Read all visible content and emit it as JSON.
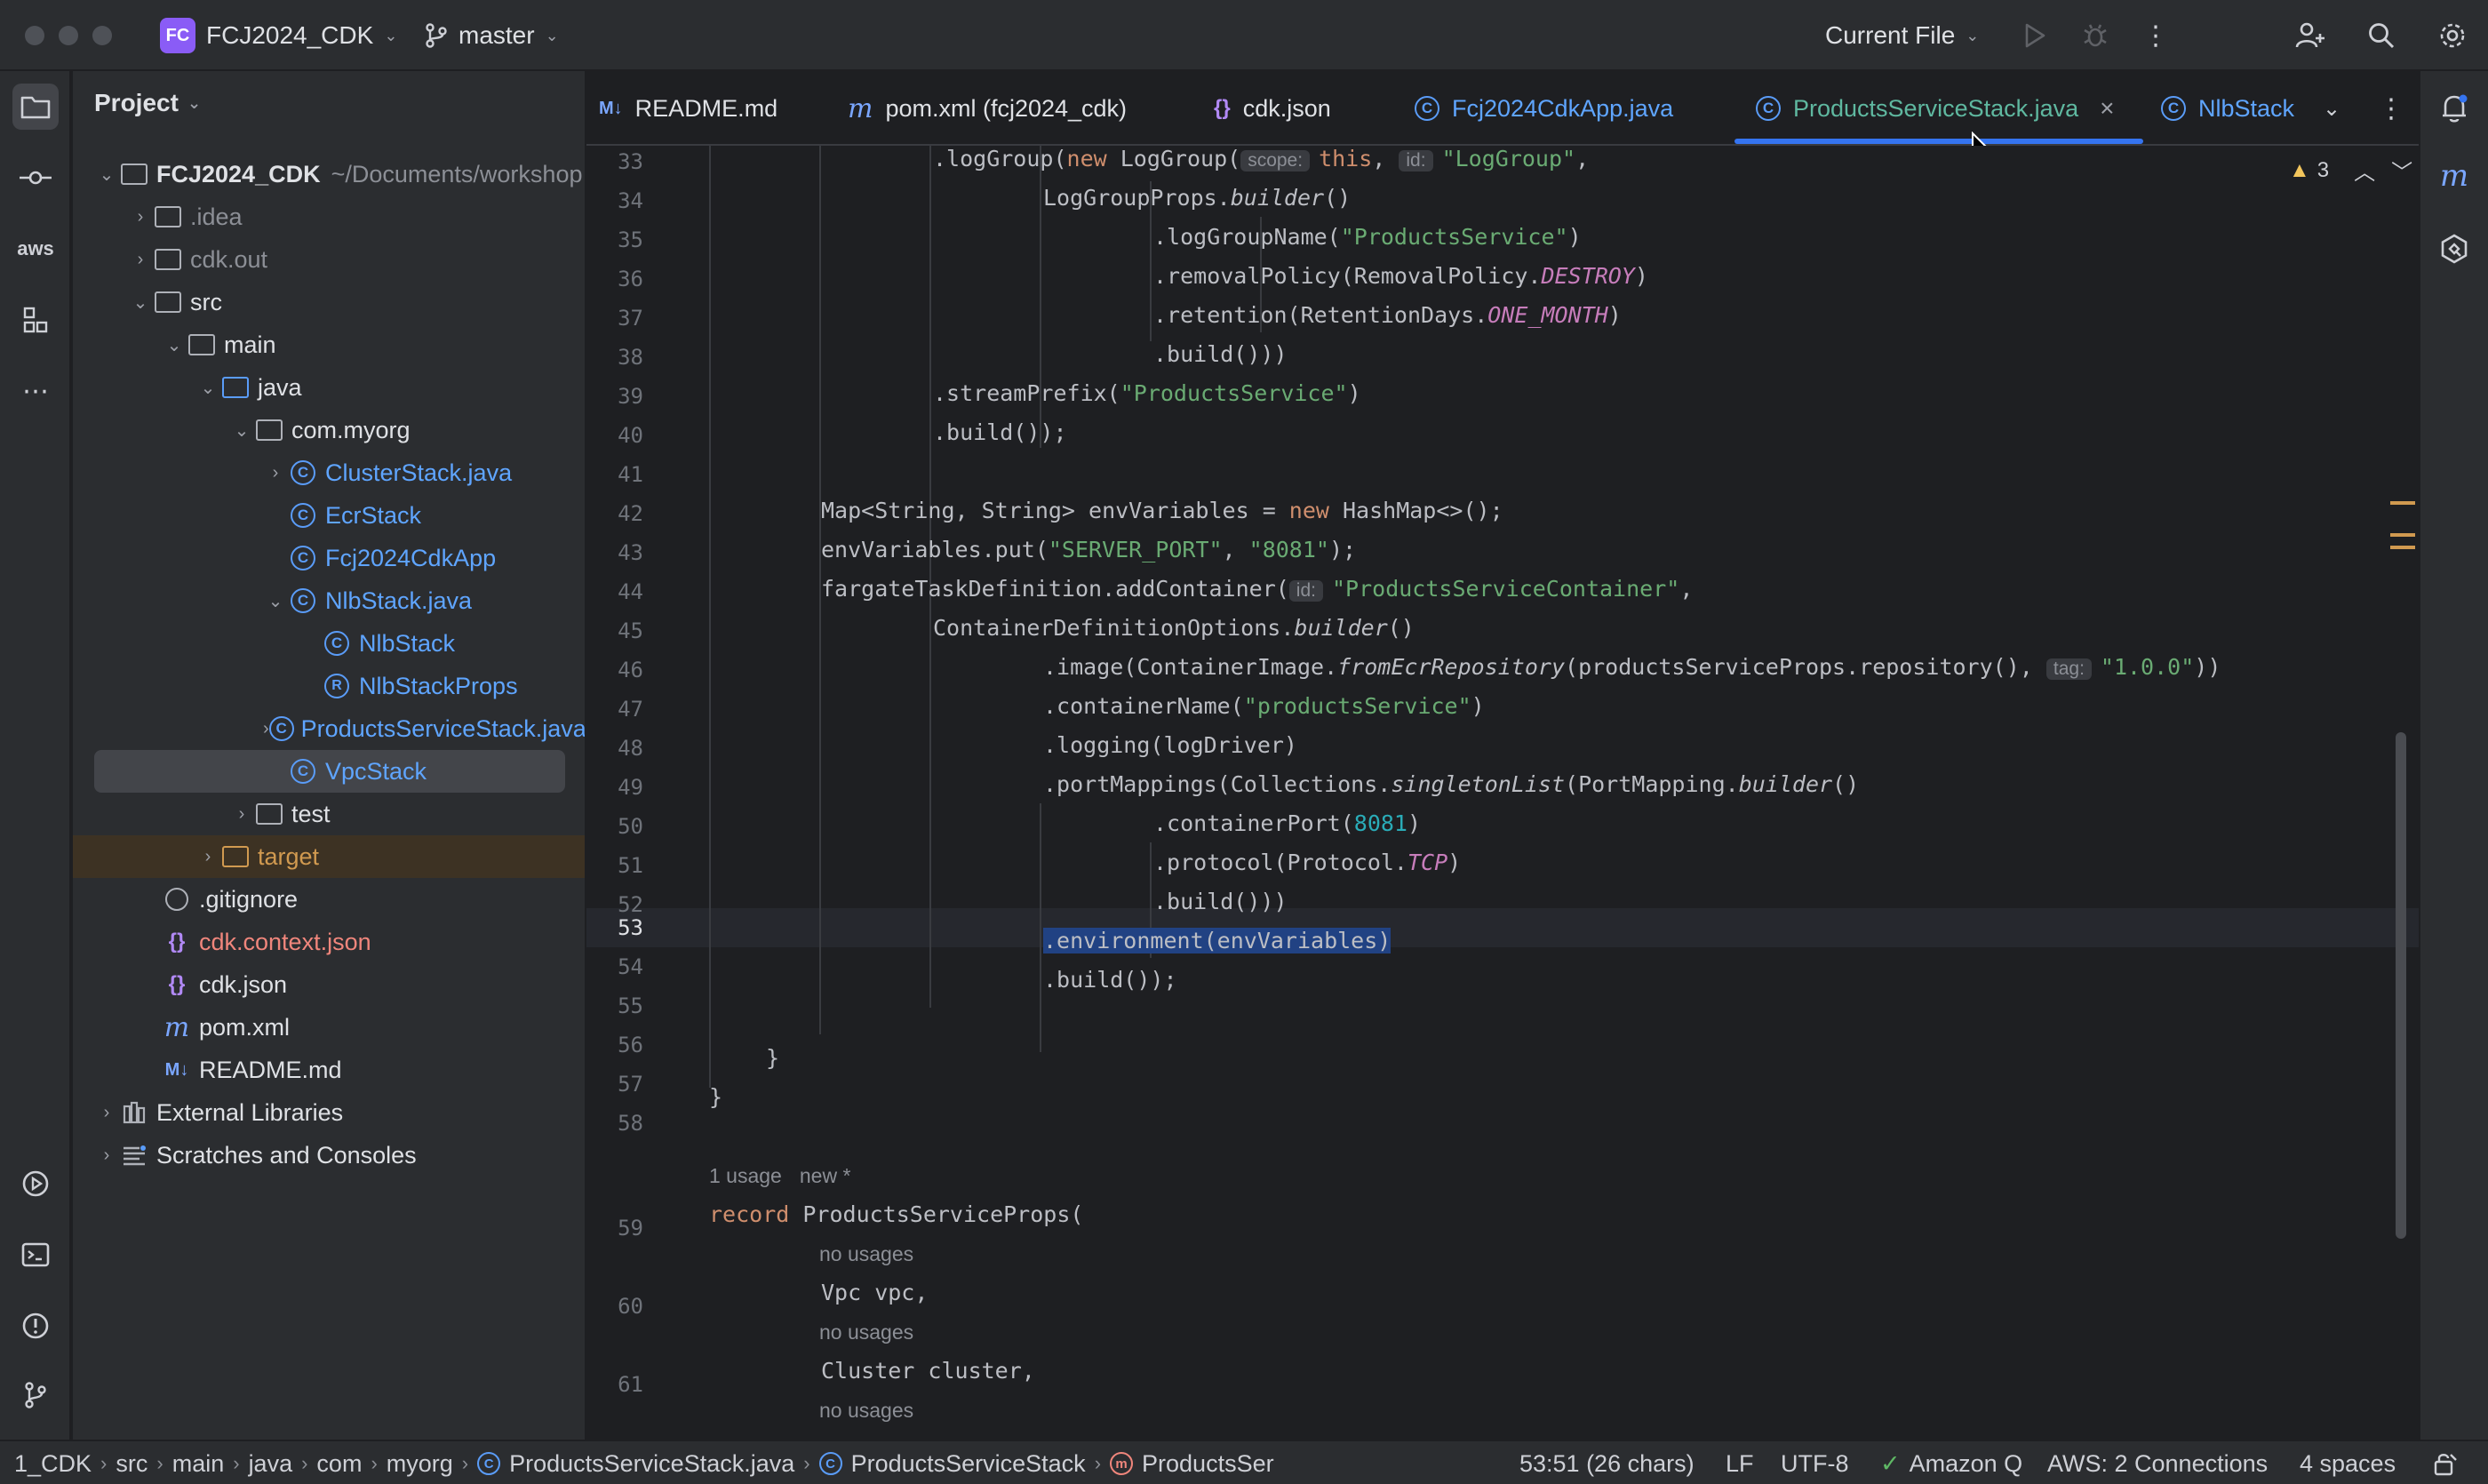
{
  "titlebar": {
    "project_badge": "FC",
    "project_name": "FCJ2024_CDK",
    "branch": "master",
    "run_config": "Current File"
  },
  "project_panel": {
    "title": "Project",
    "root_name": "FCJ2024_CDK",
    "root_path": "~/Documents/workshop",
    "items": [
      {
        "label": ".idea"
      },
      {
        "label": "cdk.out"
      },
      {
        "label": "src"
      },
      {
        "label": "main"
      },
      {
        "label": "java"
      },
      {
        "label": "com.myorg"
      },
      {
        "label": "ClusterStack.java"
      },
      {
        "label": "EcrStack"
      },
      {
        "label": "Fcj2024CdkApp"
      },
      {
        "label": "NlbStack.java"
      },
      {
        "label": "NlbStack"
      },
      {
        "label": "NlbStackProps"
      },
      {
        "label": "ProductsServiceStack.java"
      },
      {
        "label": "VpcStack"
      },
      {
        "label": "test"
      },
      {
        "label": "target"
      },
      {
        "label": ".gitignore"
      },
      {
        "label": "cdk.context.json"
      },
      {
        "label": "cdk.json"
      },
      {
        "label": "pom.xml"
      },
      {
        "label": "README.md"
      },
      {
        "label": "External Libraries"
      },
      {
        "label": "Scratches and Consoles"
      }
    ]
  },
  "tabs": [
    {
      "icon": "M↓",
      "label": "README.md"
    },
    {
      "icon": "m",
      "label": "pom.xml (fcj2024_cdk)"
    },
    {
      "icon": "{}",
      "label": "cdk.json"
    },
    {
      "icon": "C",
      "label": "Fcj2024CdkApp.java"
    },
    {
      "icon": "C",
      "label": "ProductsServiceStack.java"
    },
    {
      "icon": "C",
      "label": "NlbStack"
    }
  ],
  "editor": {
    "warning_count": "3",
    "lines": [
      {
        "n": "33"
      },
      {
        "n": "34"
      },
      {
        "n": "35"
      },
      {
        "n": "36"
      },
      {
        "n": "37"
      },
      {
        "n": "38"
      },
      {
        "n": "39"
      },
      {
        "n": "40"
      },
      {
        "n": "41"
      },
      {
        "n": "42"
      },
      {
        "n": "43"
      },
      {
        "n": "44"
      },
      {
        "n": "45"
      },
      {
        "n": "46"
      },
      {
        "n": "47"
      },
      {
        "n": "48"
      },
      {
        "n": "49"
      },
      {
        "n": "50"
      },
      {
        "n": "51"
      },
      {
        "n": "52"
      },
      {
        "n": "53"
      },
      {
        "n": "54"
      },
      {
        "n": "55"
      },
      {
        "n": "56"
      },
      {
        "n": "57"
      },
      {
        "n": "58"
      },
      {
        "n": "59"
      },
      {
        "n": "60"
      },
      {
        "n": "61"
      }
    ],
    "code": {
      "l33a": ".logGroup(",
      "l33b": "new",
      "l33c": " LogGroup(",
      "l33h1": "scope:",
      "l33d": "this",
      "l33e": ", ",
      "l33h2": "id:",
      "l33f": "\"LogGroup\"",
      "l33g": ",",
      "l34a": "LogGroupProps.",
      "l34b": "builder",
      "l34c": "()",
      "l35a": ".logGroupName(",
      "l35b": "\"ProductsService\"",
      "l35c": ")",
      "l36a": ".removalPolicy(RemovalPolicy.",
      "l36b": "DESTROY",
      "l36c": ")",
      "l37a": ".retention(RetentionDays.",
      "l37b": "ONE_MONTH",
      "l37c": ")",
      "l38a": ".build()))",
      "l39a": ".streamPrefix(",
      "l39b": "\"ProductsService\"",
      "l39c": ")",
      "l40a": ".build());",
      "l42a": "Map<String, String> envVariables = ",
      "l42b": "new",
      "l42c": " HashMap<>();",
      "l43a": "envVariables.put(",
      "l43b": "\"SERVER_PORT\"",
      "l43c": ", ",
      "l43d": "\"8081\"",
      "l43e": ");",
      "l44a": "fargateTaskDefinition.addContainer(",
      "l44h": "id:",
      "l44b": "\"ProductsServiceContainer\"",
      "l44c": ",",
      "l45a": "ContainerDefinitionOptions.",
      "l45b": "builder",
      "l45c": "()",
      "l46a": ".image(ContainerImage.",
      "l46b": "fromEcrRepository",
      "l46c": "(productsServiceProps.repository(), ",
      "l46h": "tag:",
      "l46d": "\"1.0.0\"",
      "l46e": "))",
      "l47a": ".containerName(",
      "l47b": "\"productsService\"",
      "l47c": ")",
      "l48a": ".logging(logDriver)",
      "l49a": ".portMappings(Collections.",
      "l49b": "singletonList",
      "l49c": "(PortMapping.",
      "l49d": "builder",
      "l49e": "()",
      "l50a": ".containerPort(",
      "l50b": "8081",
      "l50c": ")",
      "l51a": ".protocol(Protocol.",
      "l51b": "TCP",
      "l51c": ")",
      "l52a": ".build()))",
      "l53a": ".environment(envVariables)",
      "l54a": ".build());",
      "l56a": "}",
      "l57a": "}",
      "lens59a": "1 usage",
      "lens59b": "new *",
      "l59a": "record",
      "l59b": " ProductsServiceProps(",
      "lens60": "no usages",
      "l60a": "Vpc vpc,",
      "lens61": "no usages",
      "l61a": "Cluster cluster,",
      "lens62": "no usages"
    }
  },
  "statusbar": {
    "breadcrumbs": [
      "1_CDK",
      "src",
      "main",
      "java",
      "com",
      "myorg",
      "ProductsServiceStack.java",
      "ProductsServiceStack",
      "ProductsSer"
    ],
    "position": "53:51 (26 chars)",
    "line_ending": "LF",
    "encoding": "UTF-8",
    "amazon_q": "Amazon Q",
    "aws": "AWS: 2 Connections",
    "indent": "4 spaces"
  }
}
